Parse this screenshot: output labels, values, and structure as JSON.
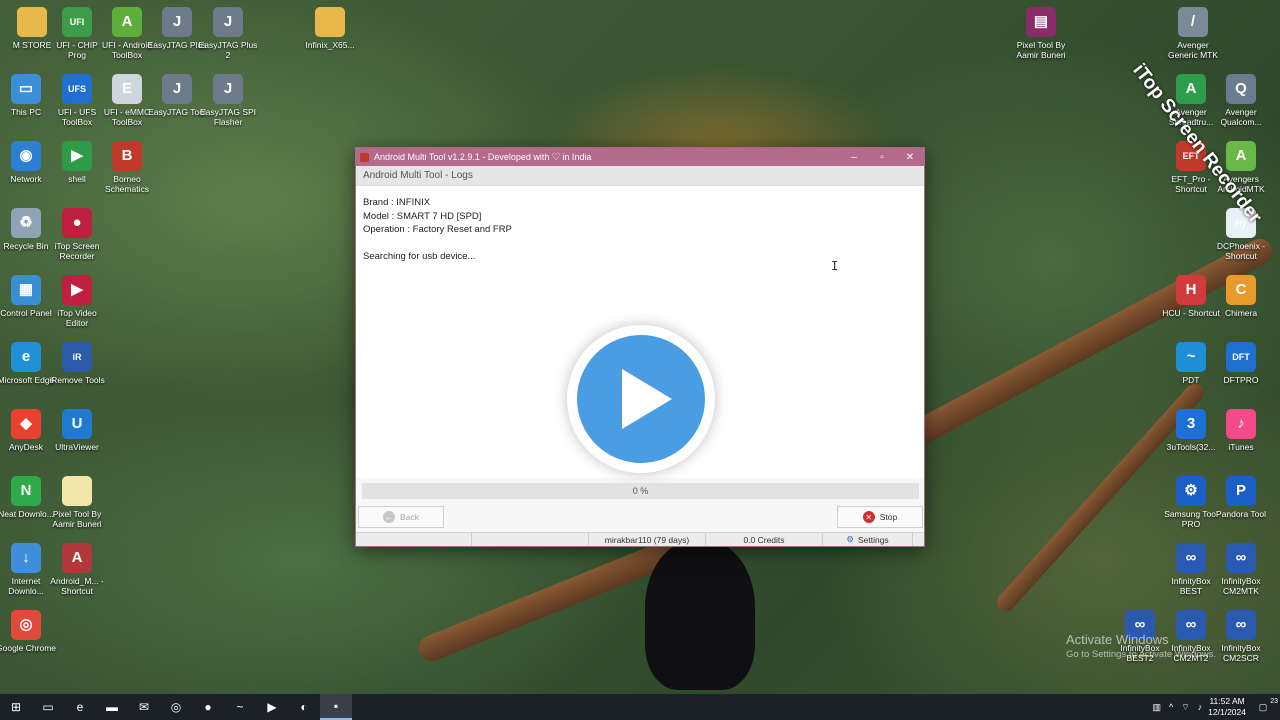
{
  "desktop": {
    "left_icons": [
      {
        "label": "M STORE",
        "icon": "folder-icon",
        "color": "#e8b84a",
        "glyph": ""
      },
      {
        "label": "UFI - CHIP Prog",
        "icon": "chip-icon",
        "color": "#3c9c48",
        "glyph": "UFI"
      },
      {
        "label": "UFI - Android ToolBox",
        "icon": "android-icon",
        "color": "#5fae3c",
        "glyph": "A"
      },
      {
        "label": "EasyJTAG Plus",
        "icon": "tool-icon",
        "color": "#6c7a89",
        "glyph": "J"
      },
      {
        "label": "EasyJTAG Plus 2",
        "icon": "tool-icon",
        "color": "#6c7a89",
        "glyph": "J"
      },
      {
        "label": "Infinix_X65...",
        "icon": "folder-icon",
        "color": "#e8b84a",
        "glyph": ""
      },
      {
        "label": "This PC",
        "icon": "computer-icon",
        "color": "#3b8ed8",
        "glyph": "▭"
      },
      {
        "label": "UFI - UFS ToolBox",
        "icon": "ufs-icon",
        "color": "#1f6fd0",
        "glyph": "UFS"
      },
      {
        "label": "UFI - eMMC ToolBox",
        "icon": "emmc-icon",
        "color": "#d0d6de",
        "glyph": "E"
      },
      {
        "label": "EasyJTAG Tool",
        "icon": "tool-icon",
        "color": "#6c7a89",
        "glyph": "J"
      },
      {
        "label": "EasyJTAG SPI Flasher",
        "icon": "tool-icon",
        "color": "#6c7a89",
        "glyph": "J"
      },
      {
        "label": "Network",
        "icon": "network-icon",
        "color": "#2d7fd3",
        "glyph": "◉"
      },
      {
        "label": "shell",
        "icon": "shell-icon",
        "color": "#2e9b48",
        "glyph": "▶"
      },
      {
        "label": "Borneo Schematics",
        "icon": "schematics-icon",
        "color": "#c0392b",
        "glyph": "B"
      },
      {
        "label": "Recycle Bin",
        "icon": "recycle-bin-icon",
        "color": "#8fa3b5",
        "glyph": "♻"
      },
      {
        "label": "iTop Screen Recorder",
        "icon": "recorder-icon",
        "color": "#c02040",
        "glyph": "●"
      },
      {
        "label": "Control Panel",
        "icon": "control-panel-icon",
        "color": "#3a8fd4",
        "glyph": "▦"
      },
      {
        "label": "iTop Video Editor",
        "icon": "video-editor-icon",
        "color": "#c02040",
        "glyph": "▶"
      },
      {
        "label": "Microsoft Edge",
        "icon": "edge-icon",
        "color": "#1f8fd6",
        "glyph": "e"
      },
      {
        "label": "iRemove Tools",
        "icon": "iremove-icon",
        "color": "#2a5aa8",
        "glyph": "iR"
      },
      {
        "label": "AnyDesk",
        "icon": "anydesk-icon",
        "color": "#e8412f",
        "glyph": "◆"
      },
      {
        "label": "UltraViewer",
        "icon": "ultraviewer-icon",
        "color": "#1e7bd0",
        "glyph": "U"
      },
      {
        "label": "Neat Downlo...",
        "icon": "download-icon",
        "color": "#2eaa4a",
        "glyph": "N"
      },
      {
        "label": "Pixel Tool By Aamir Buneri",
        "icon": "file-icon",
        "color": "#f2e6a8",
        "glyph": ""
      },
      {
        "label": "Internet Downlo...",
        "icon": "idm-icon",
        "color": "#3f8fd8",
        "glyph": "↓"
      },
      {
        "label": "Android_M... - Shortcut",
        "icon": "shortcut-icon",
        "color": "#b03a3a",
        "glyph": "A"
      },
      {
        "label": "Google Chrome",
        "icon": "chrome-icon",
        "color": "#e04a3a",
        "glyph": "◎"
      }
    ],
    "right_icons": [
      {
        "label": "Pixel Tool By Aamir Buneri",
        "icon": "archive-icon",
        "color": "#8a2c6a",
        "glyph": "▤"
      },
      {
        "label": "Avenger Generic MTK",
        "icon": "tool-icon",
        "color": "#7a8a96",
        "glyph": "/"
      },
      {
        "label": "Avenger Spreadtru...",
        "icon": "avenger-icon",
        "color": "#2e9e4c",
        "glyph": "A"
      },
      {
        "label": "Avenger Qualcom...",
        "icon": "avenger-icon",
        "color": "#6a7d8f",
        "glyph": "Q"
      },
      {
        "label": "EFT_Pro - Shortcut",
        "icon": "eft-icon",
        "color": "#c0392b",
        "glyph": "EFT"
      },
      {
        "label": "Avengers AndroidMTK",
        "icon": "android-icon",
        "color": "#6bb84a",
        "glyph": "A"
      },
      {
        "label": "DCPhoenix - Shortcut",
        "icon": "dc-phoenix-icon",
        "color": "#e8f0f8",
        "glyph": "Hy"
      },
      {
        "label": "HCU - Shortcut",
        "icon": "hcu-icon",
        "color": "#d03a3a",
        "glyph": "H"
      },
      {
        "label": "Chimera",
        "icon": "chimera-icon",
        "color": "#e89a2a",
        "glyph": "C"
      },
      {
        "label": "PDT",
        "icon": "pdt-icon",
        "color": "#1e8fd6",
        "glyph": "~"
      },
      {
        "label": "DFTPRO",
        "icon": "dftpro-icon",
        "color": "#1f6fd0",
        "glyph": "DFT"
      },
      {
        "label": "3uTools(32...",
        "icon": "3utools-icon",
        "color": "#1e6fd8",
        "glyph": "3"
      },
      {
        "label": "iTunes",
        "icon": "itunes-icon",
        "color": "#f24a8a",
        "glyph": "♪"
      },
      {
        "label": "Samsung Tool PRO",
        "icon": "samsung-tool-icon",
        "color": "#1a5fc8",
        "glyph": "⚙"
      },
      {
        "label": "Pandora Tool",
        "icon": "pandora-icon",
        "color": "#1a5fc8",
        "glyph": "P"
      },
      {
        "label": "InfinityBox BEST",
        "icon": "infinitybox-icon",
        "color": "#2a5ab0",
        "glyph": "∞"
      },
      {
        "label": "InfinityBox CM2MTK",
        "icon": "infinitybox-icon",
        "color": "#2a5ab0",
        "glyph": "∞"
      },
      {
        "label": "InfinityBox BEST2",
        "icon": "infinitybox-icon",
        "color": "#2a5ab0",
        "glyph": "∞"
      },
      {
        "label": "InfinityBox CM2MT2",
        "icon": "infinitybox-icon",
        "color": "#2a5ab0",
        "glyph": "∞"
      },
      {
        "label": "InfinityBox CM2SCR",
        "icon": "infinitybox-icon",
        "color": "#2a5ab0",
        "glyph": "∞"
      }
    ]
  },
  "watermark": {
    "text": "iTop Screen Recorder"
  },
  "activation": {
    "line1": "Activate Windows",
    "line2": "Go to Settings to activate Windows."
  },
  "window": {
    "title_prefix": "Android Multi Tool v1.2.9.1 - Developed with",
    "title_suffix": "in India",
    "heart": "♡",
    "subheader": "Android Multi Tool - Logs",
    "logs": {
      "brand": "Brand : INFINIX",
      "model": "Model : SMART 7 HD [SPD]",
      "operation": "Operation : Factory Reset and FRP",
      "status": "Searching for usb device..."
    },
    "progress": {
      "value": 0,
      "label": "0 %"
    },
    "buttons": {
      "back": "Back",
      "stop": "Stop"
    },
    "statusbar": {
      "user": "mirakbar110 (79 days)",
      "credits": "0.0 Credits",
      "settings": "Settings"
    },
    "colors": {
      "titlebar": "#b46a8b",
      "play": "#4a9de3",
      "stop": "#d03030"
    }
  },
  "taskbar": {
    "clock_time": "11:52 AM",
    "clock_date": "12/1/2024",
    "apps": [
      {
        "icon": "windows-start-icon",
        "glyph": "⊞"
      },
      {
        "icon": "task-view-icon",
        "glyph": "▭"
      },
      {
        "icon": "edge-icon",
        "glyph": "e"
      },
      {
        "icon": "file-explorer-icon",
        "glyph": "▬"
      },
      {
        "icon": "mail-icon",
        "glyph": "✉"
      },
      {
        "icon": "chrome-icon",
        "glyph": "◎"
      },
      {
        "icon": "recorder-icon",
        "glyph": "●"
      },
      {
        "icon": "pdt-icon",
        "glyph": "~"
      },
      {
        "icon": "video-editor-icon",
        "glyph": "▶"
      },
      {
        "icon": "settings-app-icon",
        "glyph": "◐"
      },
      {
        "icon": "android-multi-tool-icon",
        "glyph": "▪"
      }
    ],
    "tray": [
      {
        "icon": "network-tray-icon",
        "glyph": "▥"
      },
      {
        "icon": "chevron-up-icon",
        "glyph": "^"
      },
      {
        "icon": "wifi-icon",
        "glyph": "⌔"
      },
      {
        "icon": "volume-icon",
        "glyph": "♪"
      },
      {
        "icon": "notification-icon",
        "glyph": "▢"
      }
    ],
    "notification_count": "23"
  }
}
